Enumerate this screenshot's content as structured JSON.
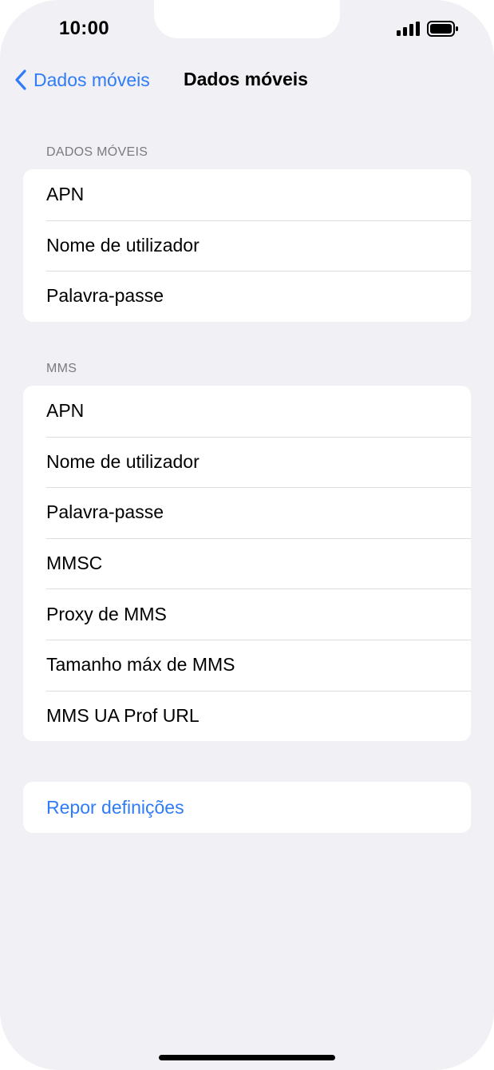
{
  "status_bar": {
    "time": "10:00"
  },
  "nav": {
    "back_label": "Dados móveis",
    "title": "Dados móveis"
  },
  "sections": {
    "mobile_data": {
      "header": "DADOS MÓVEIS",
      "items": [
        "APN",
        "Nome de utilizador",
        "Palavra-passe"
      ]
    },
    "mms": {
      "header": "MMS",
      "items": [
        "APN",
        "Nome de utilizador",
        "Palavra-passe",
        "MMSC",
        "Proxy de MMS",
        "Tamanho máx de MMS",
        "MMS UA Prof URL"
      ]
    },
    "reset": {
      "label": "Repor definições"
    }
  },
  "colors": {
    "accent": "#2f7cf6",
    "background": "#f0f0f5",
    "cell": "#ffffff",
    "secondary_text": "#7a7a80"
  }
}
